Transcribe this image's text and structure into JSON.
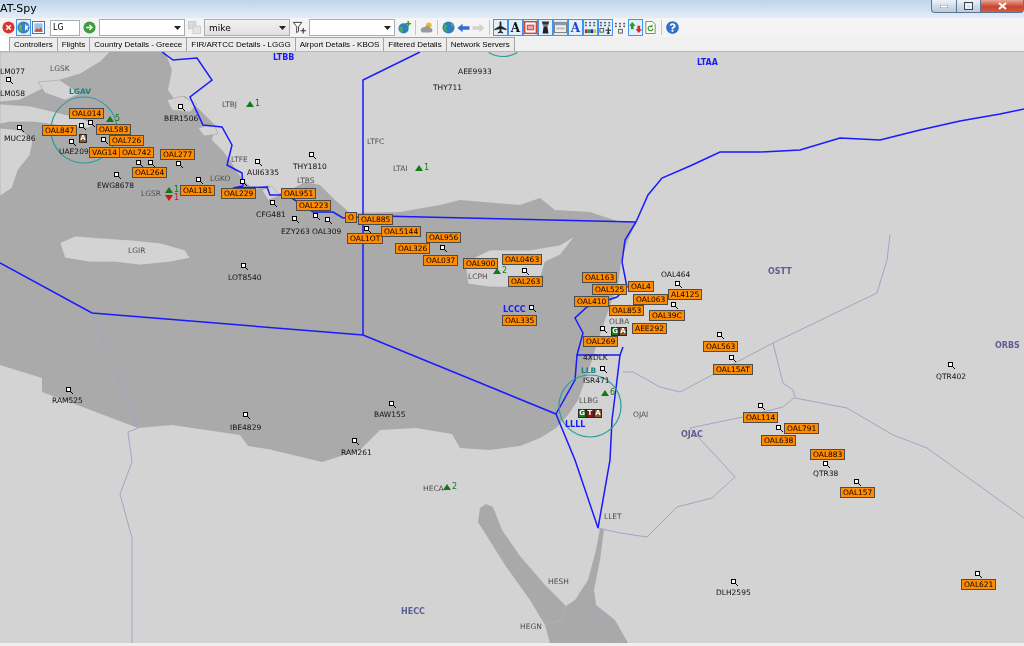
{
  "window": {
    "title": "AT-Spy"
  },
  "toolbar": {
    "groups": [
      {
        "items": [
          {
            "kind": "button",
            "pressed": false,
            "disabled": false
          },
          {
            "kind": "button",
            "pressed": true,
            "disabled": false
          },
          {
            "kind": "button",
            "pressed": false,
            "disabled": false
          },
          {
            "kind": "field",
            "value": "LG"
          },
          {
            "kind": "button",
            "pressed": false,
            "disabled": false
          },
          {
            "kind": "dropdown",
            "editable": true
          },
          {
            "kind": "button",
            "pressed": false,
            "disabled": true
          },
          {
            "kind": "dropdown",
            "editable": false,
            "value": "mike"
          },
          {
            "kind": "button",
            "pressed": false,
            "disabled": false
          },
          {
            "kind": "dropdown",
            "editable": true
          },
          {
            "kind": "button",
            "pressed": false,
            "disabled": false
          }
        ]
      },
      {
        "items": [
          {
            "kind": "button",
            "pressed": false,
            "disabled": false
          }
        ]
      },
      {
        "items": [
          {
            "kind": "button",
            "pressed": false,
            "disabled": false
          },
          {
            "kind": "button",
            "pressed": false,
            "disabled": false
          },
          {
            "kind": "button",
            "pressed": false,
            "disabled": true
          }
        ]
      },
      {
        "items": [
          {
            "kind": "button",
            "pressed": true,
            "disabled": false
          },
          {
            "kind": "button",
            "pressed": true,
            "disabled": false,
            "label": "A"
          },
          {
            "kind": "button",
            "pressed": true,
            "disabled": false
          },
          {
            "kind": "button",
            "pressed": true,
            "disabled": false
          },
          {
            "kind": "button",
            "pressed": true,
            "disabled": false
          },
          {
            "kind": "button",
            "pressed": true,
            "disabled": false,
            "label": "A"
          },
          {
            "kind": "button",
            "pressed": true,
            "disabled": false
          },
          {
            "kind": "button",
            "pressed": true,
            "disabled": false
          },
          {
            "kind": "button",
            "pressed": false,
            "disabled": false
          },
          {
            "kind": "button",
            "pressed": true,
            "disabled": false
          },
          {
            "kind": "button",
            "pressed": false,
            "disabled": false
          }
        ]
      },
      {
        "items": [
          {
            "kind": "button",
            "pressed": false,
            "disabled": false
          }
        ]
      }
    ]
  },
  "tabs": [
    {
      "selected": true
    },
    {
      "label": "Controllers",
      "selected": false
    },
    {
      "label": "Flights",
      "selected": false
    },
    {
      "label": "Country Details - Greece",
      "selected": false
    },
    {
      "label": "FIR/ARTCC Details - LGGG",
      "selected": false
    },
    {
      "label": "Airport Details - KBOS",
      "selected": false
    },
    {
      "label": "Filtered Details",
      "selected": false
    },
    {
      "label": "Network Servers",
      "selected": false
    }
  ],
  "map": {
    "fir_labels": [
      {
        "code": "LTBB",
        "online": true
      },
      {
        "code": "LTAA",
        "online": true
      },
      {
        "code": "OSTT",
        "online": false
      },
      {
        "code": "LCCC",
        "online": true
      },
      {
        "code": "ORBS",
        "online": false
      },
      {
        "code": "LLLL",
        "online": true
      },
      {
        "code": "OJAC",
        "online": false
      },
      {
        "code": "HECC",
        "online": false
      }
    ],
    "airports": [
      {
        "code": "LGSK",
        "staffed": false
      },
      {
        "code": "LGAV",
        "staffed": true
      },
      {
        "code": "LTBJ",
        "staffed": false
      },
      {
        "code": "LTFC",
        "staffed": false
      },
      {
        "code": "LTFE",
        "staffed": false
      },
      {
        "code": "LTAI",
        "staffed": false
      },
      {
        "code": "LGKO",
        "staffed": false
      },
      {
        "code": "LTBS",
        "staffed": false
      },
      {
        "code": "LGSR",
        "staffed": false
      },
      {
        "code": "LGIR",
        "staffed": false
      },
      {
        "code": "LCPH",
        "staffed": false
      },
      {
        "code": "OLBA",
        "staffed": false
      },
      {
        "code": "LLB",
        "staffed": true
      },
      {
        "code": "LLBG",
        "staffed": false
      },
      {
        "code": "OJAI",
        "staffed": false
      },
      {
        "code": "HECA",
        "staffed": false
      },
      {
        "code": "LLET",
        "staffed": false
      },
      {
        "code": "HESH",
        "staffed": false
      },
      {
        "code": "HEGN",
        "staffed": false
      }
    ],
    "traffic_counts": [
      {
        "kind": "arrivals",
        "count": "1"
      },
      {
        "kind": "arrivals",
        "count": "5"
      },
      {
        "kind": "arrivals",
        "count": "1"
      },
      {
        "kind": "arrivals",
        "count": "1"
      },
      {
        "kind": "departures",
        "count": "1"
      },
      {
        "kind": "arrivals",
        "count": "2"
      },
      {
        "kind": "arrivals",
        "count": "6"
      },
      {
        "kind": "arrivals",
        "count": "2"
      }
    ],
    "controller_badges": [
      {
        "letters": [
          {
            "text": "A",
            "kind": "approach"
          }
        ]
      },
      {
        "letters": [
          {
            "text": "G",
            "kind": "ground"
          },
          {
            "text": "A",
            "kind": "approach"
          }
        ]
      },
      {
        "letters": [
          {
            "text": "G",
            "kind": "ground"
          },
          {
            "text": "T",
            "kind": "tower"
          },
          {
            "text": "A",
            "kind": "approach"
          }
        ]
      }
    ],
    "flights": [
      {
        "callsign": "LM077",
        "tagged": false
      },
      {
        "callsign": "AEE9933",
        "tagged": false
      },
      {
        "callsign": "LM058",
        "tagged": false
      },
      {
        "callsign": "THY711",
        "tagged": false
      },
      {
        "callsign": "OAL014",
        "tagged": true
      },
      {
        "callsign": "BER1506",
        "tagged": false
      },
      {
        "callsign": "OAL847",
        "tagged": true
      },
      {
        "callsign": "OAL583",
        "tagged": true
      },
      {
        "callsign": "MUC286",
        "tagged": false
      },
      {
        "callsign": "OAL726",
        "tagged": true
      },
      {
        "callsign": "UAE209",
        "tagged": false
      },
      {
        "callsign": "VAG14",
        "tagged": true
      },
      {
        "callsign": "OAL742",
        "tagged": true
      },
      {
        "callsign": "OAL277",
        "tagged": true
      },
      {
        "callsign": "OAL264",
        "tagged": true
      },
      {
        "callsign": "AUI6335",
        "tagged": false
      },
      {
        "callsign": "THY1810",
        "tagged": false
      },
      {
        "callsign": "EWG8678",
        "tagged": false
      },
      {
        "callsign": "OAL181",
        "tagged": true
      },
      {
        "callsign": "OAL229",
        "tagged": true
      },
      {
        "callsign": "OAL951",
        "tagged": true
      },
      {
        "callsign": "OAL223",
        "tagged": true
      },
      {
        "callsign": "CFG481",
        "tagged": false
      },
      {
        "callsign": "O",
        "tagged": true
      },
      {
        "callsign": "OAL885",
        "tagged": true
      },
      {
        "callsign": "EZY263",
        "tagged": false
      },
      {
        "callsign": "OAL309",
        "tagged": false
      },
      {
        "callsign": "OAL1OT",
        "tagged": true
      },
      {
        "callsign": "OAL5144",
        "tagged": true
      },
      {
        "callsign": "OAL956",
        "tagged": true
      },
      {
        "callsign": "OAL326",
        "tagged": true
      },
      {
        "callsign": "OAL037",
        "tagged": true
      },
      {
        "callsign": "OAL900",
        "tagged": true
      },
      {
        "callsign": "OAL0463",
        "tagged": true
      },
      {
        "callsign": "LOT8540",
        "tagged": false
      },
      {
        "callsign": "OAL263",
        "tagged": true
      },
      {
        "callsign": "OAL163",
        "tagged": true
      },
      {
        "callsign": "OAL464",
        "tagged": false
      },
      {
        "callsign": "OAL525",
        "tagged": true
      },
      {
        "callsign": "OAL4",
        "tagged": true
      },
      {
        "callsign": "AL4125",
        "tagged": true
      },
      {
        "callsign": "OAL410",
        "tagged": true
      },
      {
        "callsign": "OAL063",
        "tagged": true
      },
      {
        "callsign": "OAL853",
        "tagged": true
      },
      {
        "callsign": "OAL39C",
        "tagged": true
      },
      {
        "callsign": "OAL335",
        "tagged": true
      },
      {
        "callsign": "AEE292",
        "tagged": true
      },
      {
        "callsign": "OAL269",
        "tagged": true
      },
      {
        "callsign": "OAL563",
        "tagged": true
      },
      {
        "callsign": "4XDLK",
        "tagged": false
      },
      {
        "callsign": "OAL15AT",
        "tagged": true
      },
      {
        "callsign": "ISR471",
        "tagged": false
      },
      {
        "callsign": "QTR402",
        "tagged": false
      },
      {
        "callsign": "RAM525",
        "tagged": false
      },
      {
        "callsign": "BAW155",
        "tagged": false
      },
      {
        "callsign": "OAL114",
        "tagged": true
      },
      {
        "callsign": "IBE4829",
        "tagged": false
      },
      {
        "callsign": "OAL791",
        "tagged": true
      },
      {
        "callsign": "OAL638",
        "tagged": true
      },
      {
        "callsign": "RAM261",
        "tagged": false
      },
      {
        "callsign": "OAL883",
        "tagged": true
      },
      {
        "callsign": "QTR38",
        "tagged": false
      },
      {
        "callsign": "OAL157",
        "tagged": true
      },
      {
        "callsign": "OAL621",
        "tagged": true
      },
      {
        "callsign": "DLH2595",
        "tagged": false
      }
    ]
  }
}
